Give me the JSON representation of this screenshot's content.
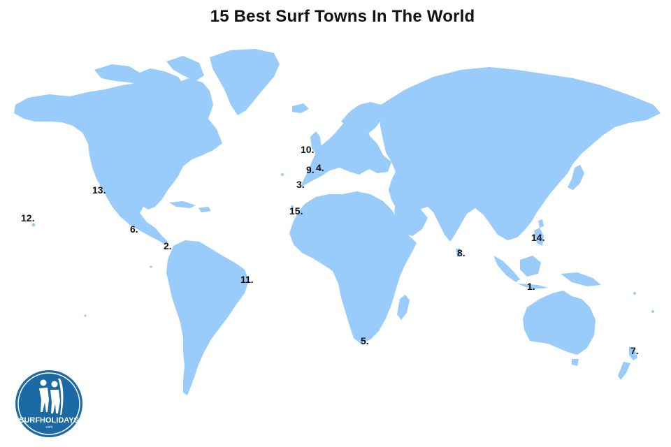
{
  "title": "15 Best Surf Towns In The World",
  "colors": {
    "land": "#99cbfb",
    "ocean": "#ffffff",
    "text": "#111111",
    "logo_blue": "#1b6aa5"
  },
  "markers": {
    "m1": "1.",
    "m2": "2.",
    "m3": "3.",
    "m4": "4.",
    "m5": "5.",
    "m6": "6.",
    "m7": "7.",
    "m8": "8.",
    "m9": "9.",
    "m10": "10.",
    "m11": "11.",
    "m12": "12.",
    "m13": "13.",
    "m14": "14.",
    "m15": "15."
  },
  "logo": {
    "brand": "SURFHOLIDAYS",
    "suffix": ".com",
    "icon": "surfers-icon"
  }
}
